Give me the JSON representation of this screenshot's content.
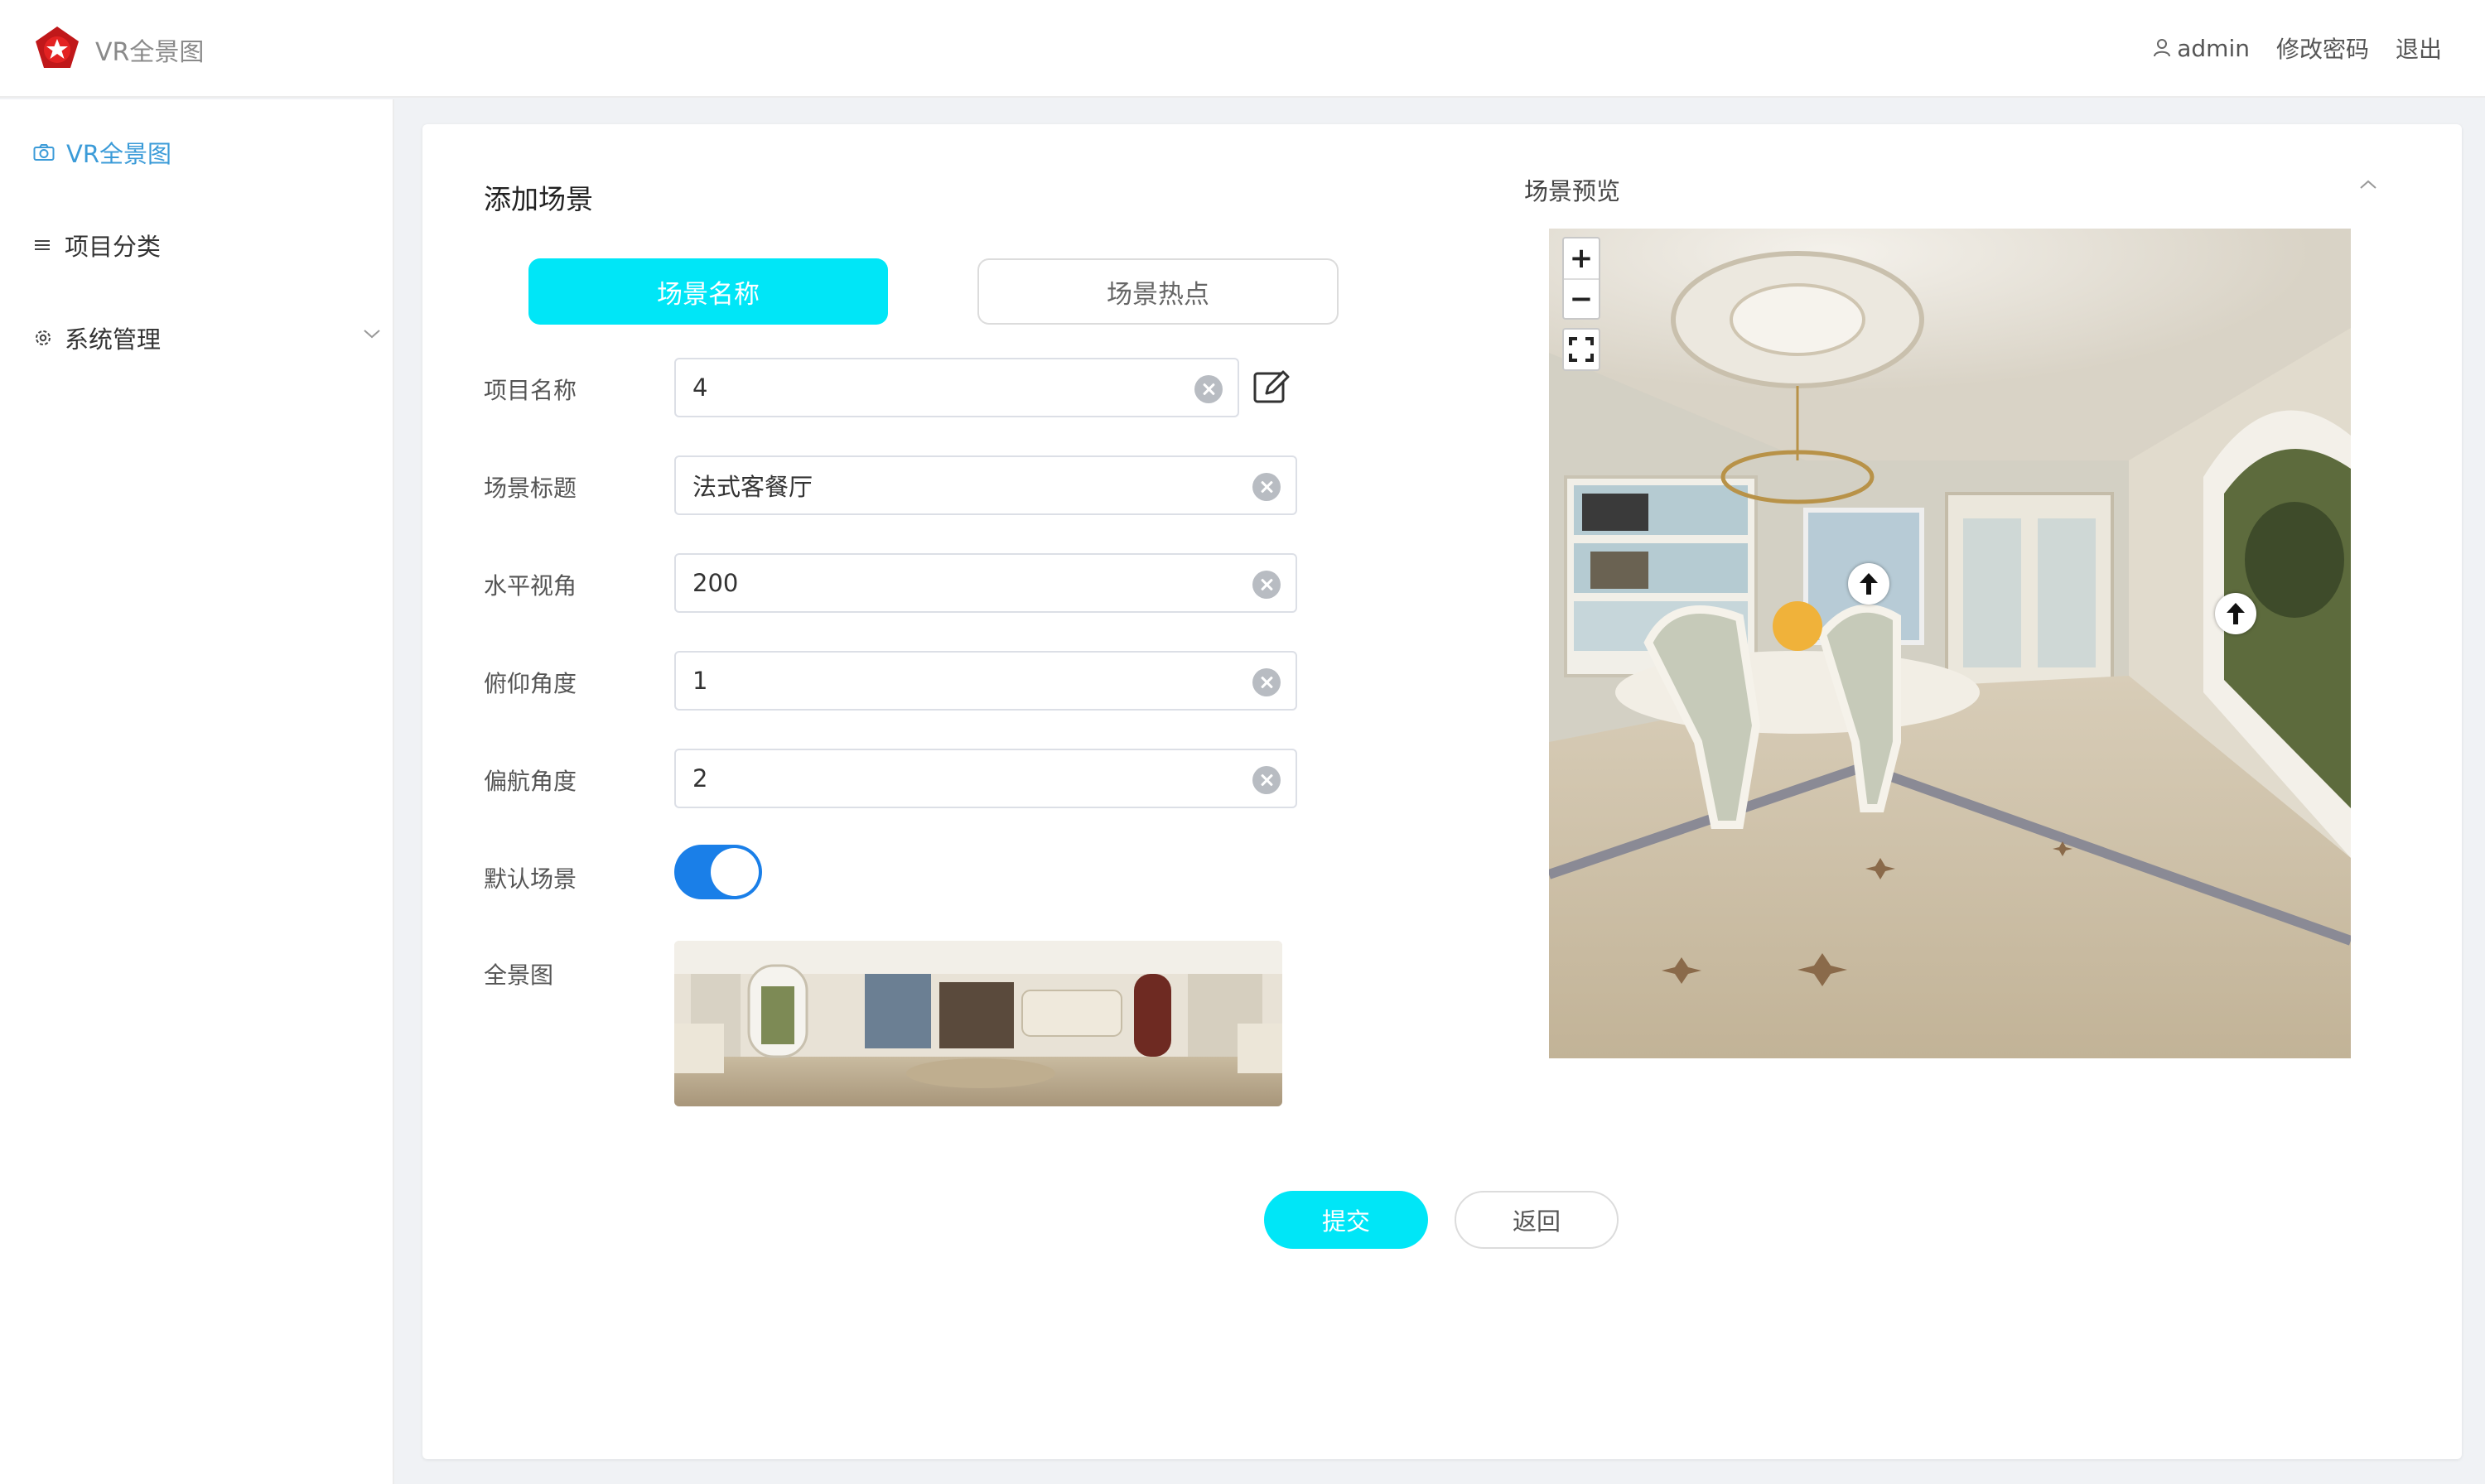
{
  "header": {
    "app_title": "VR全景图",
    "user": "admin",
    "change_password": "修改密码",
    "logout": "退出"
  },
  "sidebar": {
    "items": [
      {
        "label": "VR全景图",
        "icon": "camera-icon",
        "active": true
      },
      {
        "label": "项目分类",
        "icon": "menu-icon",
        "active": false
      },
      {
        "label": "系统管理",
        "icon": "gear-icon",
        "active": false
      }
    ]
  },
  "form": {
    "title": "添加场景",
    "tabs": [
      "场景名称",
      "场景热点"
    ],
    "fields": {
      "project_name": {
        "label": "项目名称",
        "value": "4"
      },
      "scene_title": {
        "label": "场景标题",
        "value": "法式客餐厅"
      },
      "horizontal_fov": {
        "label": "水平视角",
        "value": "200"
      },
      "pitch": {
        "label": "俯仰角度",
        "value": "1"
      },
      "yaw": {
        "label": "偏航角度",
        "value": "2"
      },
      "default_scene": {
        "label": "默认场景",
        "on": true
      },
      "panorama": {
        "label": "全景图"
      }
    },
    "submit": "提交",
    "back": "返回"
  },
  "preview": {
    "title": "场景预览",
    "zoom_in": "+",
    "zoom_out": "−"
  },
  "colors": {
    "accent": "#00e6f7",
    "toggle": "#1a7fe8",
    "sidebar_active": "#3b9bd8"
  }
}
